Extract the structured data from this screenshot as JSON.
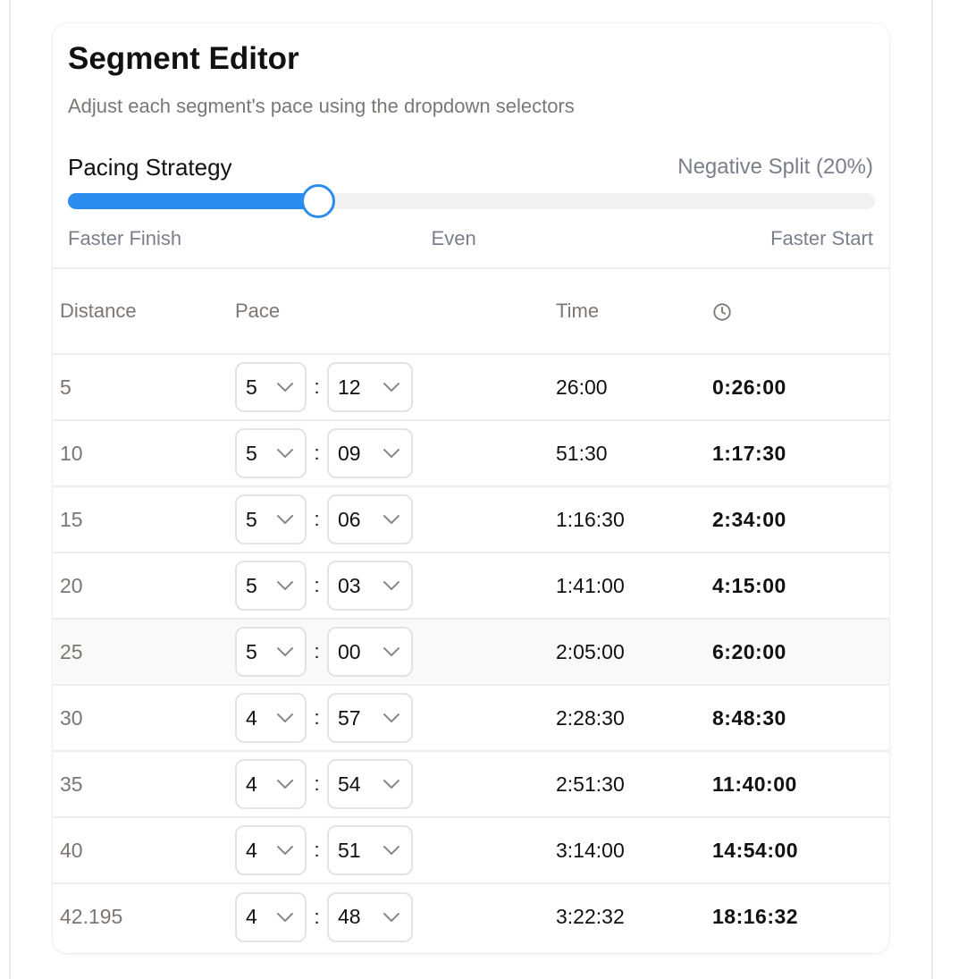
{
  "editor": {
    "title": "Segment Editor",
    "subtitle": "Adjust each segment's pace using the dropdown selectors",
    "strategy_label": "Pacing Strategy",
    "strategy_value": "Negative Split (20%)",
    "slider": {
      "position_percent": 31,
      "scale_left": "Faster Finish",
      "scale_center": "Even",
      "scale_right": "Faster Start"
    }
  },
  "colors": {
    "accent": "#2b8def",
    "track": "#f1f1f0"
  },
  "table": {
    "headers": {
      "distance": "Distance",
      "pace": "Pace",
      "time": "Time",
      "cumulative_icon": "clock-icon"
    },
    "rows": [
      {
        "distance": "5",
        "pace_min": "5",
        "pace_sec": "12",
        "time": "26:00",
        "cumulative": "0:26:00",
        "highlighted": false
      },
      {
        "distance": "10",
        "pace_min": "5",
        "pace_sec": "09",
        "time": "51:30",
        "cumulative": "1:17:30",
        "highlighted": false
      },
      {
        "distance": "15",
        "pace_min": "5",
        "pace_sec": "06",
        "time": "1:16:30",
        "cumulative": "2:34:00",
        "highlighted": false
      },
      {
        "distance": "20",
        "pace_min": "5",
        "pace_sec": "03",
        "time": "1:41:00",
        "cumulative": "4:15:00",
        "highlighted": false
      },
      {
        "distance": "25",
        "pace_min": "5",
        "pace_sec": "00",
        "time": "2:05:00",
        "cumulative": "6:20:00",
        "highlighted": true
      },
      {
        "distance": "30",
        "pace_min": "4",
        "pace_sec": "57",
        "time": "2:28:30",
        "cumulative": "8:48:30",
        "highlighted": false
      },
      {
        "distance": "35",
        "pace_min": "4",
        "pace_sec": "54",
        "time": "2:51:30",
        "cumulative": "11:40:00",
        "highlighted": false
      },
      {
        "distance": "40",
        "pace_min": "4",
        "pace_sec": "51",
        "time": "3:14:00",
        "cumulative": "14:54:00",
        "highlighted": false
      },
      {
        "distance": "42.195",
        "pace_min": "4",
        "pace_sec": "48",
        "time": "3:22:32",
        "cumulative": "18:16:32",
        "highlighted": false
      }
    ]
  }
}
